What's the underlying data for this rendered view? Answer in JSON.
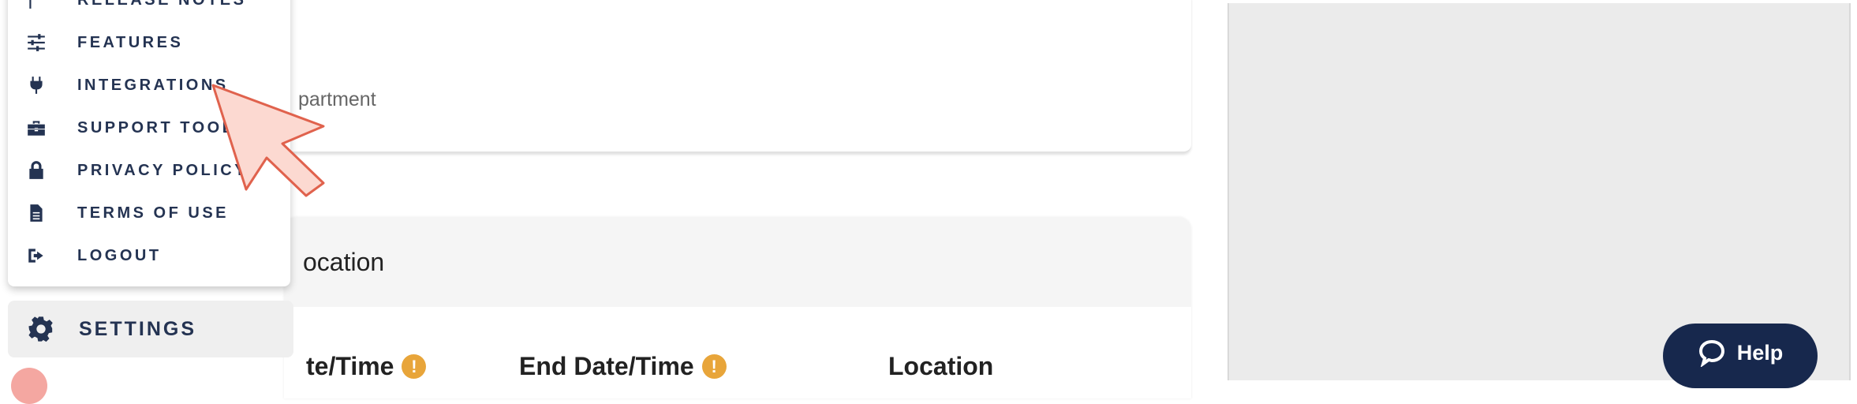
{
  "menu": {
    "items": [
      {
        "label": "RELEASE NOTES",
        "icon": "flag-icon"
      },
      {
        "label": "FEATURES",
        "icon": "sliders-icon"
      },
      {
        "label": "INTEGRATIONS",
        "icon": "plug-icon"
      },
      {
        "label": "SUPPORT TOOLS",
        "icon": "toolbox-icon"
      },
      {
        "label": "PRIVACY POLICY",
        "icon": "lock-icon"
      },
      {
        "label": "TERMS OF USE",
        "icon": "document-icon"
      },
      {
        "label": "LOGOUT",
        "icon": "logout-icon"
      }
    ],
    "settings_label": "SETTINGS"
  },
  "main": {
    "department_text": "partment",
    "location_card_title": "ocation",
    "columns": [
      "te/Time",
      "End Date/Time",
      "Location"
    ],
    "warning_glyph": "!"
  },
  "help": {
    "label": "Help"
  },
  "colors": {
    "nav_text": "#243352",
    "help_bg": "#17284d",
    "warning": "#e8a53a",
    "pointer_fill": "#fcd9d1",
    "pointer_stroke": "#e0624d"
  }
}
